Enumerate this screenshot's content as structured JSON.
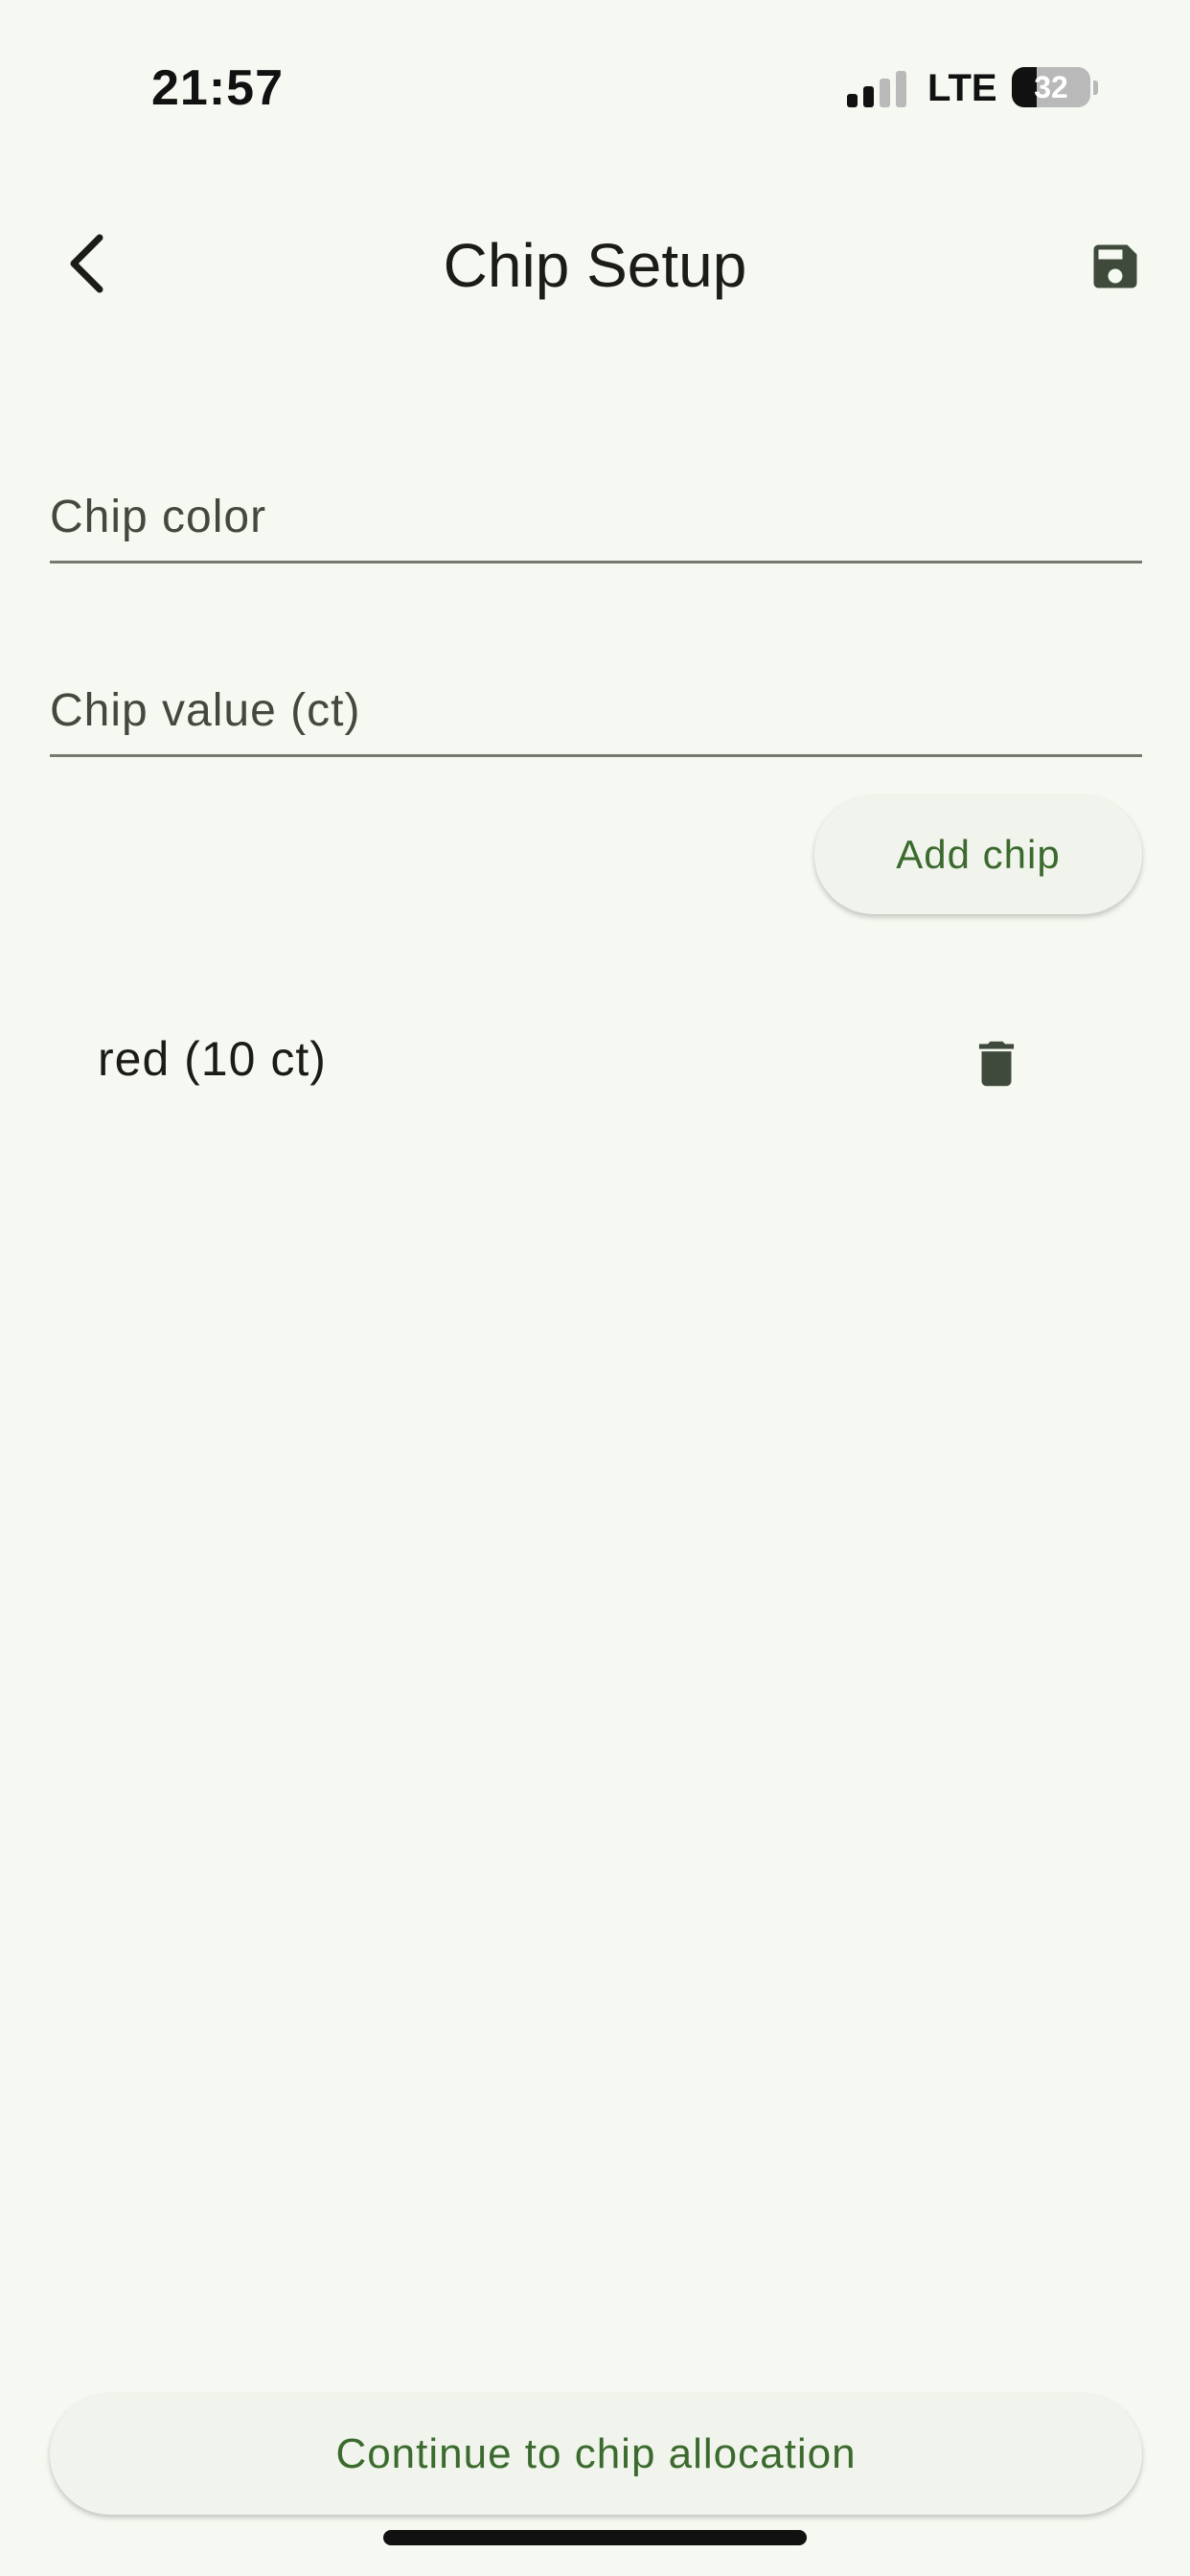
{
  "status_bar": {
    "time": "21:57",
    "network": "LTE",
    "battery_percent": "32",
    "battery_level": 0.32,
    "signal_bars_active": 2,
    "signal_bars_total": 4
  },
  "app_bar": {
    "title": "Chip Setup",
    "back_icon": "chevron-left-icon",
    "save_icon": "floppy-disk-icon"
  },
  "form": {
    "chip_color_placeholder": "Chip color",
    "chip_color_value": "",
    "chip_value_placeholder": "Chip value (ct)",
    "chip_value_value": "",
    "add_button_label": "Add chip"
  },
  "chips": [
    {
      "label": "red (10 ct)",
      "delete_icon": "trash-icon"
    }
  ],
  "footer": {
    "continue_label": "Continue to chip allocation"
  },
  "colors": {
    "background": "#f6f9f1",
    "accent_text": "#3b6a2e",
    "icon": "#3f4a3c"
  }
}
